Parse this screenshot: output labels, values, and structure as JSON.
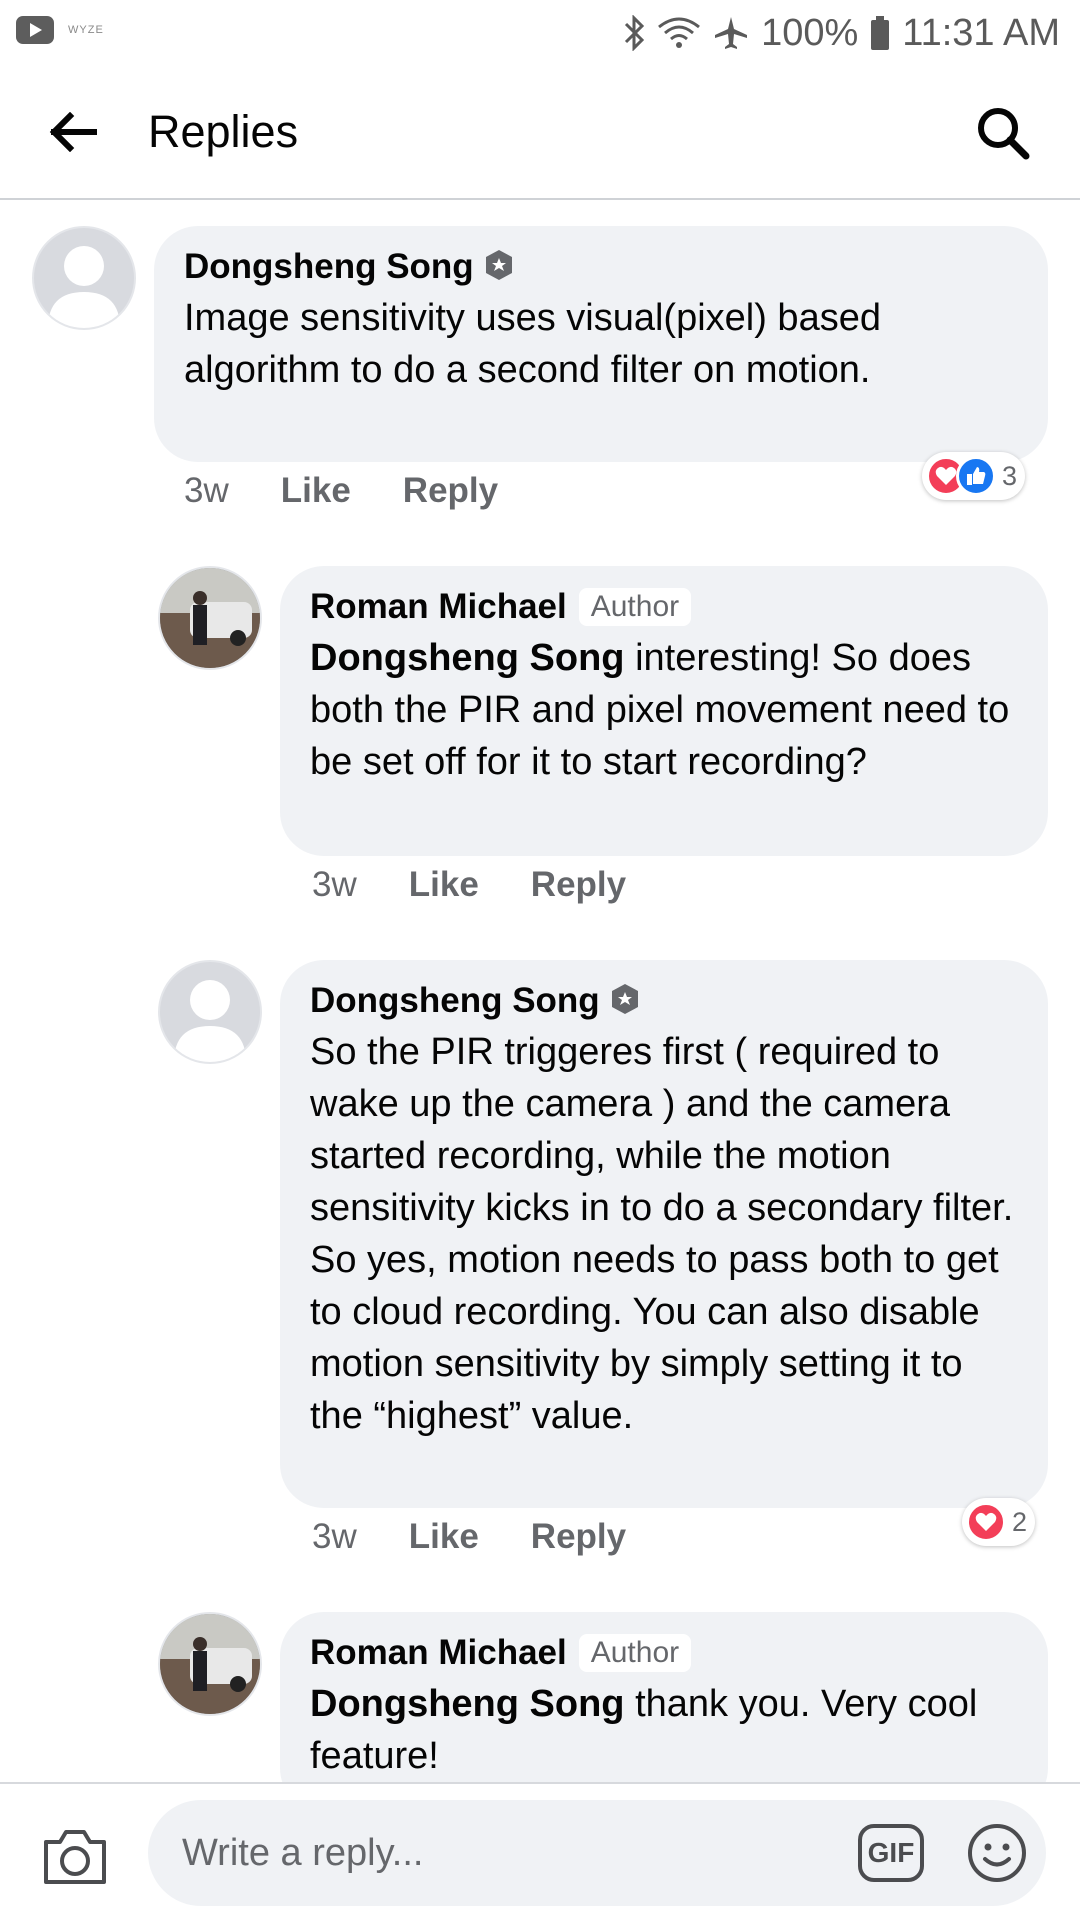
{
  "status_bar": {
    "app_label": "WYZE",
    "battery": "100%",
    "time": "11:31 AM",
    "icons": [
      "youtube-icon",
      "bluetooth-icon",
      "wifi-icon",
      "airplane-icon",
      "battery-icon"
    ]
  },
  "header": {
    "title": "Replies",
    "back_icon": "back-arrow-icon",
    "search_icon": "search-icon"
  },
  "comments": [
    {
      "author": "Dongsheng Song",
      "badge": "moderator-badge-icon",
      "text": "Image sensitivity uses visual(pixel) based algorithm to do a second filter on motion.",
      "age": "3w",
      "like_label": "Like",
      "reply_label": "Reply",
      "reactions": [
        "love",
        "like"
      ],
      "reaction_count": "3"
    },
    {
      "author": "Roman Michael",
      "author_tag": "Author",
      "mention": "Dongsheng Song",
      "text": "interesting! So does both the PIR and pixel movement need to be set off for it to start recording?",
      "age": "3w",
      "like_label": "Like",
      "reply_label": "Reply"
    },
    {
      "author": "Dongsheng Song",
      "badge": "moderator-badge-icon",
      "text": "So the PIR triggeres first ( required to wake up the camera ) and the camera started recording, while the motion sensitivity kicks in to do a secondary filter. So yes, motion needs to pass both to get to cloud recording.  You can also disable motion sensitivity by simply setting it to the “highest” value.",
      "age": "3w",
      "like_label": "Like",
      "reply_label": "Reply",
      "reactions": [
        "love"
      ],
      "reaction_count": "2"
    },
    {
      "author": "Roman Michael",
      "author_tag": "Author",
      "mention": "Dongsheng Song",
      "text": "thank you. Very cool feature!"
    }
  ],
  "composer": {
    "placeholder": "Write a reply...",
    "gif_label": "GIF",
    "camera_icon": "camera-icon",
    "emoji_icon": "emoji-icon"
  },
  "colors": {
    "bubble": "#f0f2f5",
    "secondary_text": "#65676b",
    "love": "#f33e58",
    "like": "#1877f2"
  }
}
